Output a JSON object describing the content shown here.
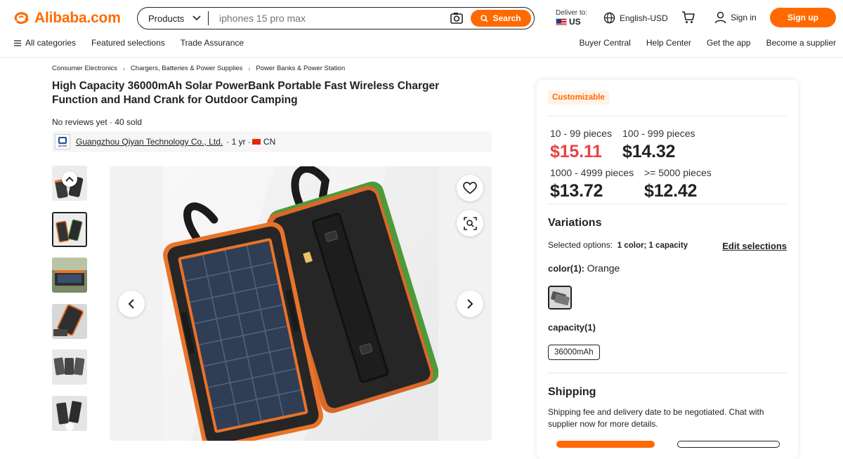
{
  "header": {
    "logo_text": "Alibaba.com",
    "search": {
      "category": "Products",
      "placeholder": "iphones 15 pro max",
      "button": "Search"
    },
    "deliver_label": "Deliver to:",
    "deliver_country": "US",
    "language": "English-USD",
    "sign_in": "Sign in",
    "sign_up": "Sign up",
    "nav_left": [
      "All categories",
      "Featured selections",
      "Trade Assurance"
    ],
    "nav_right": [
      "Buyer Central",
      "Help Center",
      "Get the app",
      "Become a supplier"
    ],
    "accent_color": "#ff6a00"
  },
  "breadcrumb": [
    "Consumer Electronics",
    "Chargers, Batteries & Power Supplies",
    "Power Banks & Power Station"
  ],
  "product": {
    "title": "High Capacity 36000mAh Solar PowerBank Portable Fast Wireless Charger Function and Hand Crank for Outdoor Camping",
    "meta": "No reviews yet · 40 sold",
    "supplier_logo_text": "QIYAN",
    "supplier_name": "Guangzhou Qiyan Technology Co., Ltd.",
    "supplier_years": "· 1 yr ·",
    "supplier_country": "CN"
  },
  "gallery": {
    "thumb_count": 6,
    "active_index": 1,
    "icons": [
      "chevron-up-icon",
      "chevron-left-icon",
      "chevron-right-icon",
      "heart-icon",
      "image-search-icon"
    ]
  },
  "panel": {
    "badge": "Customizable",
    "tiers": [
      {
        "range": "10 - 99 pieces",
        "price": "$15.11"
      },
      {
        "range": "100 - 999 pieces",
        "price": "$14.32"
      },
      {
        "range": "1000 - 4999 pieces",
        "price": "$13.72"
      },
      {
        "range": ">= 5000 pieces",
        "price": "$12.42"
      }
    ],
    "highlight_price_color": "#e64545",
    "variations_title": "Variations",
    "selected_label": "Selected options:",
    "selected_value": "1 color; 1 capacity",
    "edit_selections": "Edit selections",
    "color_label": "color(1):",
    "color_value": "Orange",
    "capacity_label": "capacity(1)",
    "capacity_value": "36000mAh",
    "shipping_title": "Shipping",
    "shipping_text": "Shipping fee and delivery date to be negotiated. Chat with supplier now for more details."
  }
}
